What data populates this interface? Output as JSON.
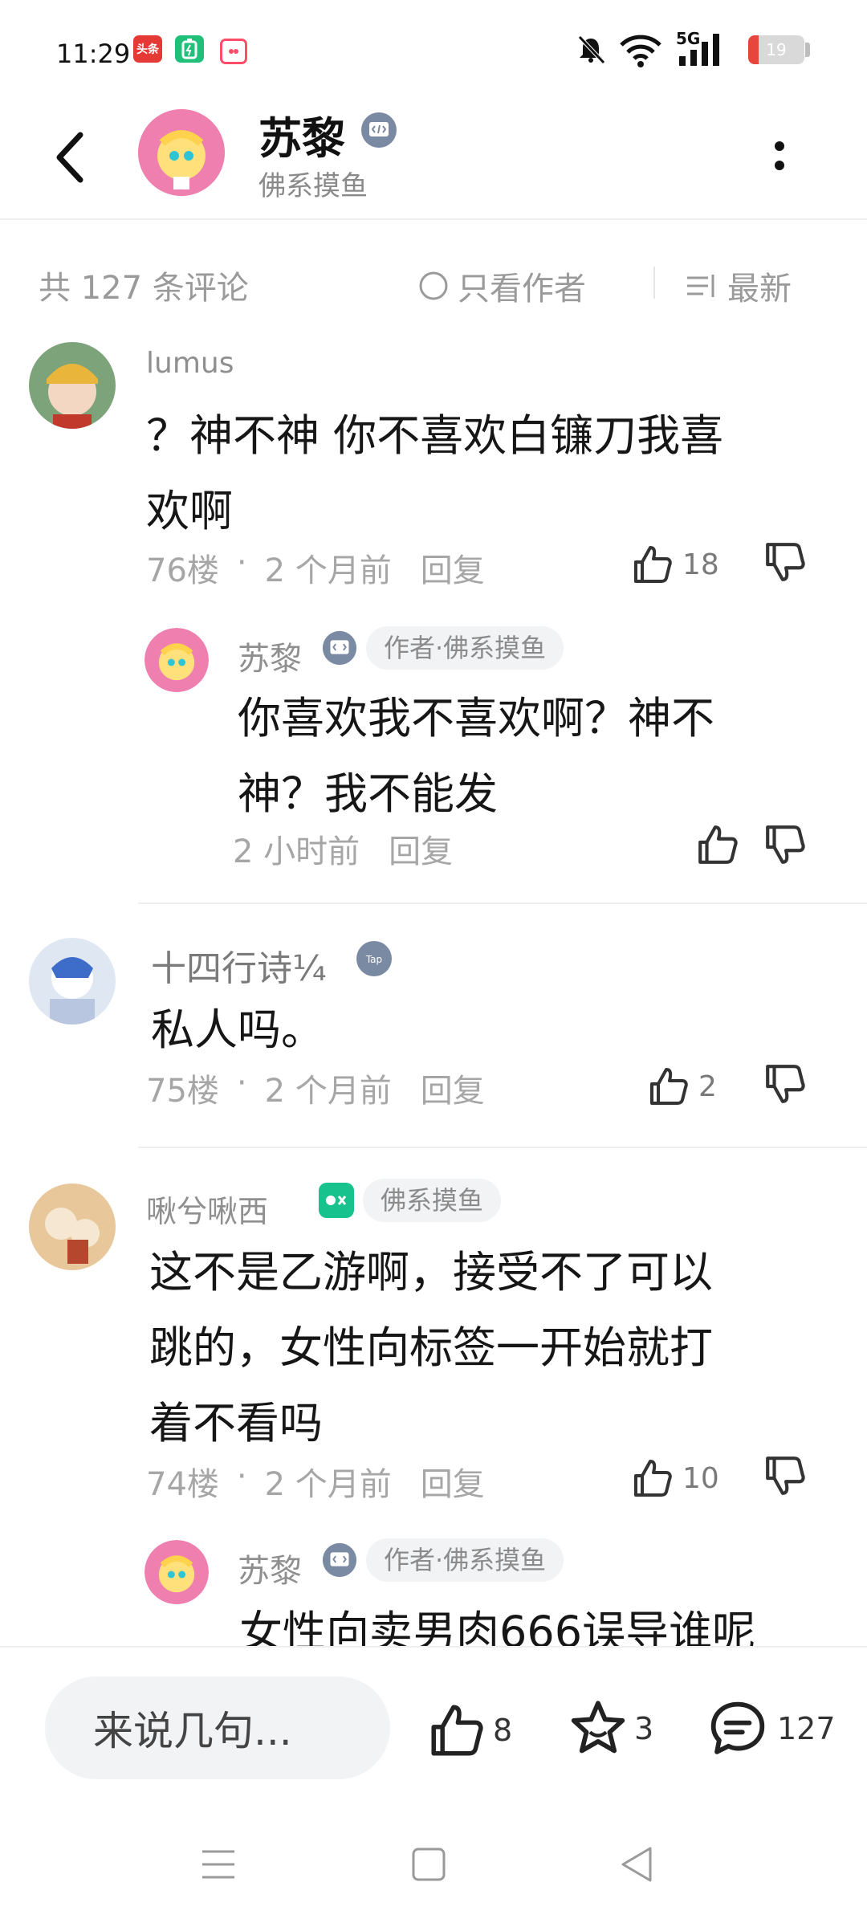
{
  "status_bar": {
    "time": "11:29",
    "apps": [
      {
        "name": "toutiao-icon",
        "label": "头条",
        "color": "#e53935"
      },
      {
        "name": "battery-app-icon",
        "label": "",
        "color": "#20c07a"
      },
      {
        "name": "video-app-icon",
        "label": "",
        "color": "#ff4d6a"
      }
    ],
    "network": "5G",
    "battery_level": "19",
    "battery_fraction": 0.19
  },
  "header": {
    "author_name": "苏黎",
    "author_tag": "佛系摸鱼",
    "back_icon": "back-arrow-icon",
    "more_icon": "more-vertical-icon"
  },
  "meta": {
    "total": "共 127 条评论",
    "only_author": "只看作者",
    "sort": "最新"
  },
  "comments": [
    {
      "nick": "lumus",
      "text_lines": [
        "？神不神 你不喜欢白镰刀我喜",
        "欢啊"
      ],
      "floor": "76楼",
      "time": "2 个月前",
      "reply": "回复",
      "likes": "18",
      "reply_item": {
        "nick": "苏黎",
        "badge": "作者·佛系摸鱼",
        "text_lines": [
          "你喜欢我不喜欢啊？神不",
          "神？我不能发"
        ],
        "time": "2 小时前",
        "reply": "回复"
      }
    },
    {
      "nick": "十四行诗¼",
      "text_lines": [
        "私人吗。"
      ],
      "floor": "75楼",
      "time": "2 个月前",
      "reply": "回复",
      "likes": "2"
    },
    {
      "nick": "啾兮啾西",
      "badge": "佛系摸鱼",
      "text_lines": [
        "这不是乙游啊，接受不了可以",
        "跳的，女性向标签一开始就打",
        "着不看吗"
      ],
      "floor": "74楼",
      "time": "2 个月前",
      "reply": "回复",
      "likes": "10",
      "reply_item": {
        "nick": "苏黎",
        "badge": "作者·佛系摸鱼",
        "text_lines": [
          "女性向卖男肉666误导谁呢"
        ]
      }
    }
  ],
  "bottom_bar": {
    "input_placeholder": "来说几句...",
    "likes": "8",
    "favorites": "3",
    "comments": "127"
  }
}
